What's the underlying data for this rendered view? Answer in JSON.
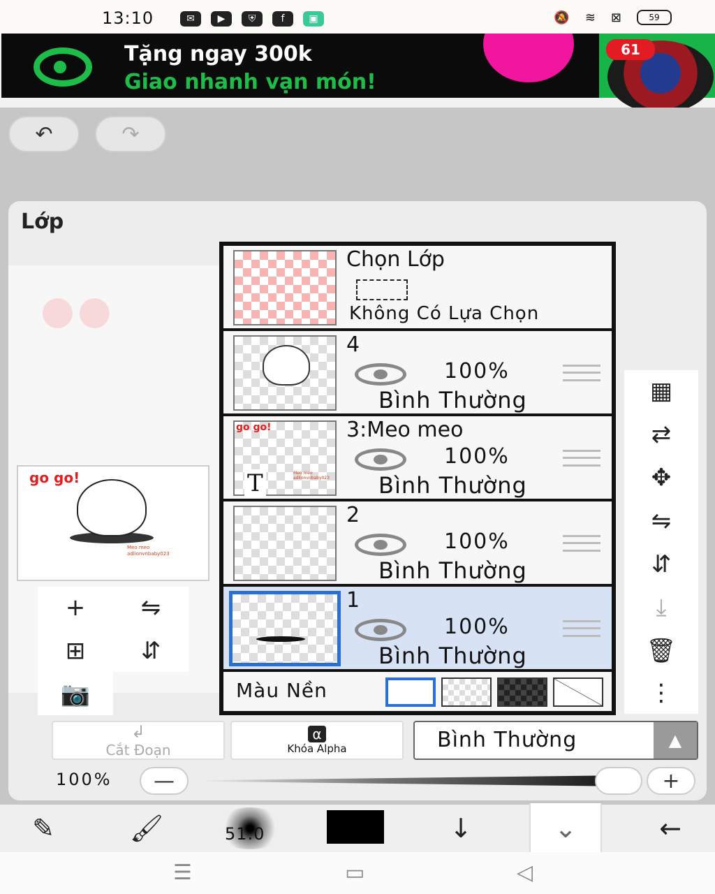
{
  "status_bar": {
    "time": "13:10",
    "app_icons": [
      "messenger-icon",
      "youtube-icon",
      "shield-icon",
      "facebook-icon",
      "gift-icon"
    ],
    "battery": "59"
  },
  "ad": {
    "line1": "Tặng ngay 300k",
    "line2": "Giao nhanh vạn món!",
    "badge": "61",
    "brand_color": "#1ebd4a"
  },
  "panel": {
    "title": "Lớp"
  },
  "preview": {
    "red_text": "go go!",
    "watermark1": "Meo meo",
    "watermark2": "adlionvnbaby023"
  },
  "selection_layer": {
    "name": "Chọn Lớp",
    "status": "Không Có Lựa Chọn"
  },
  "layers": [
    {
      "name": "4",
      "opacity": "100%",
      "blend": "Bình Thường",
      "selected": false
    },
    {
      "name": "3:Meo meo",
      "opacity": "100%",
      "blend": "Bình Thường",
      "selected": false
    },
    {
      "name": "2",
      "opacity": "100%",
      "blend": "Bình Thường",
      "selected": false
    },
    {
      "name": "1",
      "opacity": "100%",
      "blend": "Bình Thường",
      "selected": true
    }
  ],
  "layer3_thumb": {
    "red_text": "go go!",
    "text_glyph": "T",
    "watermark1": "Meo meo",
    "watermark2": "adlionvnbaby023"
  },
  "background_color": {
    "label": "Màu Nền",
    "options": [
      "white",
      "transparent",
      "dark-checker",
      "none"
    ],
    "selected": "white"
  },
  "controls": {
    "clip_label": "Cắt Đoạn",
    "alpha_lock_label": "Khóa Alpha",
    "alpha_symbol": "α",
    "blend_mode": "Bình Thường",
    "opacity": "100%",
    "opacity_value": 1.0,
    "minus": "—",
    "plus": "+"
  },
  "toolbar": {
    "brush_size": "51.0",
    "color": "#000000"
  },
  "colors": {
    "selected_layer_bg": "#d7e3f4",
    "selected_border": "#2a6fd2"
  }
}
